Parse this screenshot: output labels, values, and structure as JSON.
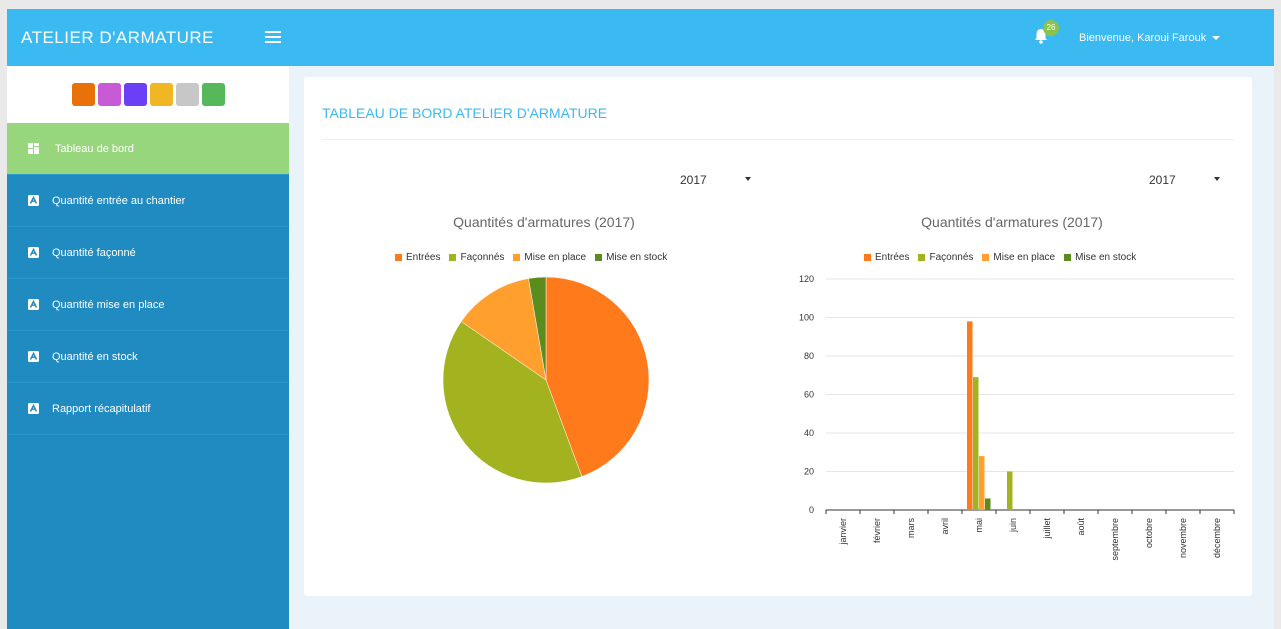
{
  "header": {
    "brand": "ATELIER D'ARMATURE",
    "notification_count": "26",
    "user_label": "Bienvenue, Karoui Farouk"
  },
  "theme_swatches": [
    "#e8710a",
    "#c95ad6",
    "#6a3ff6",
    "#f0b623",
    "#c7c7c7",
    "#56b75b"
  ],
  "sidebar": {
    "items": [
      {
        "label": "Tableau de bord",
        "active": true,
        "icon": "dashboard-icon"
      },
      {
        "label": "Quantité entrée au chantier",
        "active": false,
        "icon": "report-icon"
      },
      {
        "label": "Quantité façonné",
        "active": false,
        "icon": "report-icon"
      },
      {
        "label": "Quantité mise en place",
        "active": false,
        "icon": "report-icon"
      },
      {
        "label": "Quantité en stock",
        "active": false,
        "icon": "report-icon"
      },
      {
        "label": "Rapport récapitulatif",
        "active": false,
        "icon": "report-icon"
      }
    ]
  },
  "main": {
    "title": "TABLEAU DE BORD ATELIER D'ARMATURE",
    "left": {
      "year": "2017"
    },
    "right": {
      "year": "2017"
    }
  },
  "colors": {
    "Entrées": "#ff7a1a",
    "Façonnés": "#a3b21f",
    "Mise en place": "#ff9f2e",
    "Mise en stock": "#5b8c1e"
  },
  "chart_data": [
    {
      "type": "pie",
      "title": "Quantités d'armatures (2017)",
      "legend": [
        "Entrées",
        "Façonnés",
        "Mise en place",
        "Mise en stock"
      ],
      "legend_placement": "top",
      "values": [
        98,
        89,
        28,
        6
      ]
    },
    {
      "type": "bar",
      "title": "Quantités d'armatures (2017)",
      "legend": [
        "Entrées",
        "Façonnés",
        "Mise en place",
        "Mise en stock"
      ],
      "legend_placement": "top",
      "categories": [
        "janvier",
        "février",
        "mars",
        "avril",
        "mai",
        "juin",
        "juillet",
        "août",
        "septembre",
        "octobre",
        "novembre",
        "décembre"
      ],
      "series": [
        {
          "name": "Entrées",
          "values": [
            0,
            0,
            0,
            0,
            98,
            0,
            0,
            0,
            0,
            0,
            0,
            0
          ]
        },
        {
          "name": "Façonnés",
          "values": [
            0,
            0,
            0,
            0,
            69,
            20,
            0,
            0,
            0,
            0,
            0,
            0
          ]
        },
        {
          "name": "Mise en place",
          "values": [
            0,
            0,
            0,
            0,
            28,
            0,
            0,
            0,
            0,
            0,
            0,
            0
          ]
        },
        {
          "name": "Mise en stock",
          "values": [
            0,
            0,
            0,
            0,
            6,
            0,
            0,
            0,
            0,
            0,
            0,
            0
          ]
        }
      ],
      "y_ticks": [
        "0",
        "20",
        "40",
        "60",
        "80",
        "100",
        "120"
      ],
      "ylim": [
        0,
        120
      ],
      "grid": true
    }
  ]
}
